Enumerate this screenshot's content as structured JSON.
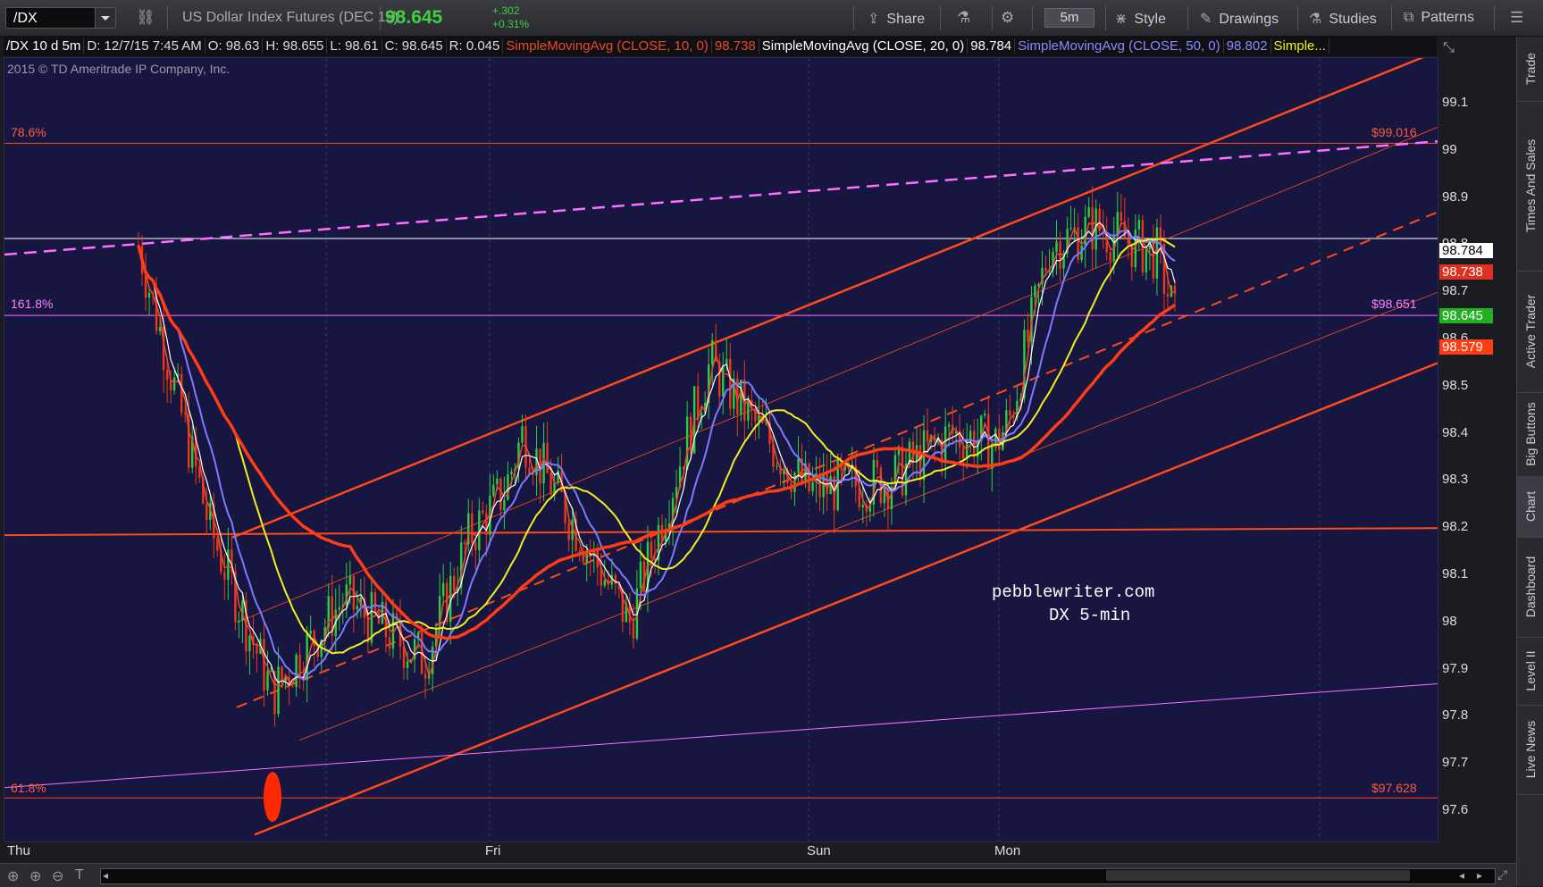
{
  "toolbar": {
    "symbol": "/DX",
    "description": "US Dollar Index Futures (DEC 15)",
    "last_price": "98.645",
    "change_abs": "+.302",
    "change_pct": "+0.31%",
    "share": "Share",
    "timeframe": "5m",
    "style": "Style",
    "drawings": "Drawings",
    "studies": "Studies",
    "patterns": "Patterns"
  },
  "infobar": {
    "chart_desc": "/DX 10 d 5m",
    "date": "D: 12/7/15 7:45 AM",
    "open": "O: 98.63",
    "high": "H: 98.655",
    "low": "L: 98.61",
    "close": "C: 98.645",
    "range": "R: 0.045",
    "sma10_label": "SimpleMovingAvg (CLOSE, 10, 0)",
    "sma10_value": "98.738",
    "sma20_label": "SimpleMovingAvg (CLOSE, 20, 0)",
    "sma20_value": "98.784",
    "sma50_label": "SimpleMovingAvg (CLOSE, 50, 0)",
    "sma50_value": "98.802",
    "sma_more": "Simple..."
  },
  "copyright": "2015 © TD Ameritrade IP Company, Inc.",
  "watermark": {
    "line1": "pebblewriter.com",
    "line2": "DX 5-min"
  },
  "fib": {
    "f786": "78.6%",
    "f786_price": "$99.016",
    "f1618": "161.8%",
    "f1618_price": "$98.651",
    "f618": "61.8%",
    "f618_price": "$97.628"
  },
  "price_tags": {
    "sma20": "98.784",
    "sma10": "98.738",
    "last": "98.645",
    "sma200": "98.579"
  },
  "colors": {
    "plot_bg": "#161640",
    "up": "#2ecc40",
    "down": "#e83a1a",
    "sma10": "#e84a2a",
    "sma20": "#ffffff",
    "sma50": "#7b7bff",
    "sma100": "#f0f020",
    "sma200": "#ff3c14",
    "channel": "#ff4a1a",
    "fib_magenta": "#ff70ff"
  },
  "side_tabs": [
    "Trade",
    "Times And Sales",
    "Active Trader",
    "Big Buttons",
    "Chart",
    "Dashboard",
    "Level II",
    "Live News"
  ],
  "chart_data": {
    "type": "candlestick",
    "interval": "5m",
    "period": "10 d",
    "title": "",
    "x_ticks": [
      "Thu",
      "Fri",
      "Sun",
      "Mon"
    ],
    "y_ticks": [
      97.6,
      97.7,
      97.8,
      97.9,
      98.0,
      98.1,
      98.2,
      98.3,
      98.4,
      98.5,
      98.6,
      98.7,
      98.8,
      98.9,
      99.0,
      99.1
    ],
    "ylim": [
      97.55,
      99.2
    ],
    "ohlc_last": {
      "open": 98.63,
      "high": 98.655,
      "low": 98.61,
      "close": 98.645
    },
    "close_path": [
      [
        0,
        98.8
      ],
      [
        1,
        98.2
      ],
      [
        2,
        97.85
      ],
      [
        3,
        98.05
      ],
      [
        4,
        97.92
      ],
      [
        5,
        98.18
      ],
      [
        6,
        98.28
      ],
      [
        7,
        98.4
      ],
      [
        8,
        98.0
      ],
      [
        9,
        98.55
      ],
      [
        10,
        98.42
      ],
      [
        11,
        98.28
      ],
      [
        12,
        98.3
      ],
      [
        13,
        98.4
      ],
      [
        14,
        98.38
      ],
      [
        15,
        98.43
      ],
      [
        16,
        98.8
      ],
      [
        17,
        98.84
      ],
      [
        18,
        98.78
      ],
      [
        19,
        98.645
      ]
    ],
    "series": [
      {
        "name": "SimpleMovingAvg (CLOSE, 10, 0)",
        "last": 98.738
      },
      {
        "name": "SimpleMovingAvg (CLOSE, 20, 0)",
        "last": 98.784
      },
      {
        "name": "SimpleMovingAvg (CLOSE, 50, 0)",
        "last": 98.802
      }
    ],
    "horizontal_levels": [
      99.016,
      98.651,
      97.628,
      98.814
    ]
  }
}
